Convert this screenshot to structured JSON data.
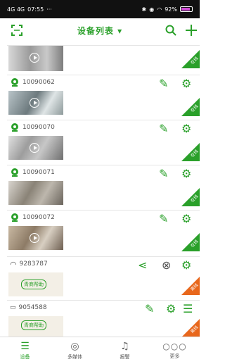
{
  "status": {
    "time": "07:55",
    "signal": "4G 4G",
    "battery": "92%",
    "dots": "···"
  },
  "header": {
    "title": "设备列表",
    "title_arrow": "▾"
  },
  "devices": [
    {
      "id": "",
      "kind": "camera-partial",
      "badge": "在线"
    },
    {
      "id": "10090062",
      "kind": "camera",
      "badge": "在线"
    },
    {
      "id": "10090070",
      "kind": "camera",
      "badge": "在线"
    },
    {
      "id": "10090071",
      "kind": "camera",
      "badge": "在线"
    },
    {
      "id": "10090072",
      "kind": "camera",
      "badge": "在线"
    },
    {
      "id": "9283787",
      "kind": "wifi",
      "badge": "离线",
      "thumb_label": "青商帮助"
    },
    {
      "id": "9054588",
      "kind": "dvr",
      "badge": "离线",
      "thumb_label": "青商帮助"
    }
  ],
  "nav": [
    {
      "label": "设备"
    },
    {
      "label": "多媒体"
    },
    {
      "label": "报警"
    },
    {
      "label": "更多"
    }
  ],
  "colors": {
    "accent": "#2aa02a",
    "offline": "#e8671c"
  }
}
